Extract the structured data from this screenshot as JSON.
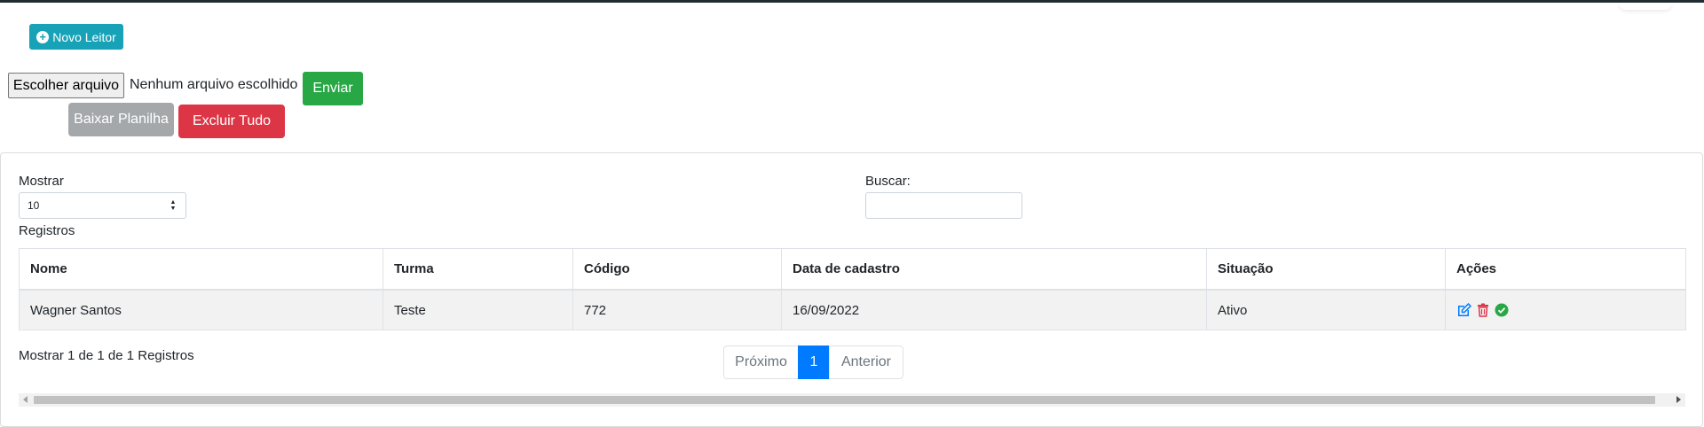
{
  "toolbar": {
    "new_reader_label": "Novo Leitor",
    "choose_file_label": "Escolher arquivo",
    "file_status": "Nenhum arquivo escolhido",
    "send_label": "Enviar",
    "download_sheet_label": "Baixar Planilha",
    "delete_all_label": "Excluir Tudo"
  },
  "controls": {
    "show_label": "Mostrar",
    "page_size_value": "10",
    "records_label": "Registros",
    "search_label": "Buscar:",
    "search_value": ""
  },
  "table": {
    "headers": [
      "Nome",
      "Turma",
      "Código",
      "Data de cadastro",
      "Situação",
      "Ações"
    ],
    "rows": [
      {
        "nome": "Wagner Santos",
        "turma": "Teste",
        "codigo": "772",
        "data": "16/09/2022",
        "situacao": "Ativo"
      }
    ]
  },
  "footer": {
    "info": "Mostrar 1 de 1 de 1 Registros",
    "next_label": "Próximo",
    "current_page": "1",
    "prev_label": "Anterior"
  },
  "colors": {
    "info": "#17a2b8",
    "success": "#28a745",
    "secondary": "#a5a8ab",
    "danger": "#dc3545",
    "primary": "#007bff"
  }
}
